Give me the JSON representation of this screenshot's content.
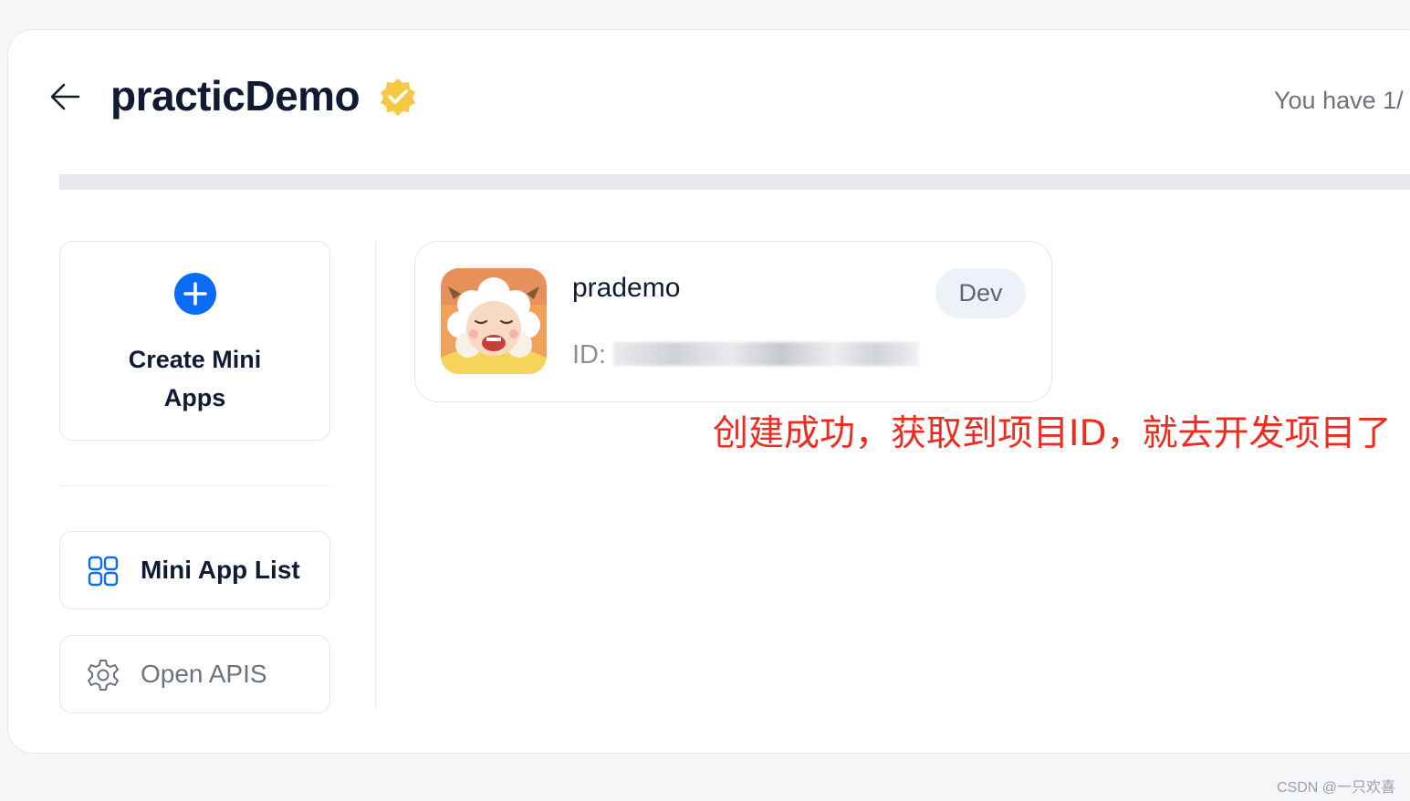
{
  "header": {
    "title": "practicDemo",
    "quota_text": "You have 1/"
  },
  "sidebar": {
    "create_label": "Create Mini Apps",
    "items": [
      {
        "label": "Mini App List",
        "icon": "grid-icon"
      },
      {
        "label": "Open APIS",
        "icon": "gear-icon"
      }
    ]
  },
  "app_card": {
    "name": "prademo",
    "id_label": "ID:",
    "id_value": "1",
    "badge": "Dev"
  },
  "annotation": "创建成功，获取到项目ID，就去开发项目了",
  "watermark": "CSDN @一只欢喜",
  "colors": {
    "accent": "#0a6cf5",
    "verified": "#f6c944",
    "annotation": "#f02a1e",
    "title": "#101b33"
  }
}
